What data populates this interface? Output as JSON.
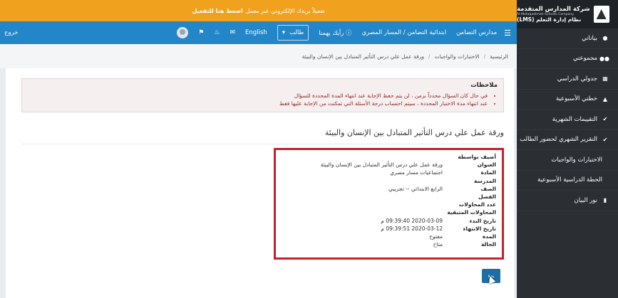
{
  "brand": {
    "name_ar": "شركة المدارس المتقدمة",
    "name_en": "Al-Motaqadimah Schools Company",
    "lms": "نظام إدارة التعلم (LMS)"
  },
  "sidebar": {
    "items": [
      {
        "label": "بياناتي",
        "icon": "user-icon"
      },
      {
        "label": "مجموعتي",
        "icon": "group-icon"
      },
      {
        "label": "جدولي الدراسي",
        "icon": "grid-icon"
      },
      {
        "label": "خطتي الأسبوعية",
        "icon": "chart-icon"
      },
      {
        "label": "التقييمات الشهرية",
        "icon": "check-icon"
      },
      {
        "label": "التقرير الشهري لحضور الطالب",
        "icon": "check-icon"
      },
      {
        "label": "الاختبارات والواجبات",
        "icon": ""
      },
      {
        "label": "الخطة الدراسية الأسبوعية",
        "icon": ""
      },
      {
        "label": "نور البيان",
        "icon": "book-icon"
      }
    ]
  },
  "announce": {
    "text": "تفعيلاً بريدك الإلكتروني عبر معمل",
    "link": "اضغط هنا للتفعيل"
  },
  "navbar": {
    "menu_icon": "☰",
    "items": [
      "مدارس التضامن",
      "ابتدائية التضامن / المسار المصري",
      "رأيك يهمنا"
    ],
    "role_select": "طالب",
    "language": "English",
    "logout": "خروج"
  },
  "breadcrumb": [
    "الرئيسية",
    "الاختبارات والواجبات",
    "ورقة عمل علي درس التأثير المتبادل بين الإنسان والبيئة"
  ],
  "notes": {
    "title": "ملاحظات",
    "items": [
      "في حال كان السؤال محدداً بزمن ، لن يتم حفظ الإجابة عند انتهاء المدة المحددة للسؤال",
      "عند انتهاء مدة الاختبار المحددة ، سيتم احتساب درجة الأسئلة التي تمكنت من الإجابة عليها فقط"
    ]
  },
  "page_title": "ورقة عمل علي درس التأثير المتبادل بين الإنسان والبيئة",
  "details": [
    {
      "label": "أضيف بواسطة",
      "value": ""
    },
    {
      "label": "العنوان",
      "value": "ورقة عمل علي درس التأثير المتبادل بين الإنسان والبيئة"
    },
    {
      "label": "المادة",
      "value": "اجتماعيات مسار مصري"
    },
    {
      "label": "المدرسة",
      "value": ""
    },
    {
      "label": "الصف",
      "value": "الرابع الابتدائي -- تجريبي"
    },
    {
      "label": "الفصل",
      "value": ""
    },
    {
      "label": "عدد المحاولات",
      "value": ""
    },
    {
      "label": "المحاولات المتبقية",
      "value": ""
    },
    {
      "label": "تاريخ البدء",
      "value": "2020-03-09 09:39:40 م"
    },
    {
      "label": "تاريخ الانتهاء",
      "value": "2020-03-12 09:39:51 م"
    },
    {
      "label": "المدة",
      "value": "مفتوح"
    },
    {
      "label": "الحالة",
      "value": "متاح"
    }
  ],
  "start_button": "بدء",
  "colors": {
    "sidebar_bg": "#2b2f33",
    "announce_bg": "#f0a21e",
    "navbar_bg": "#2386c8",
    "highlight_border": "#c0232b",
    "notes_text": "#8b2b2b"
  }
}
